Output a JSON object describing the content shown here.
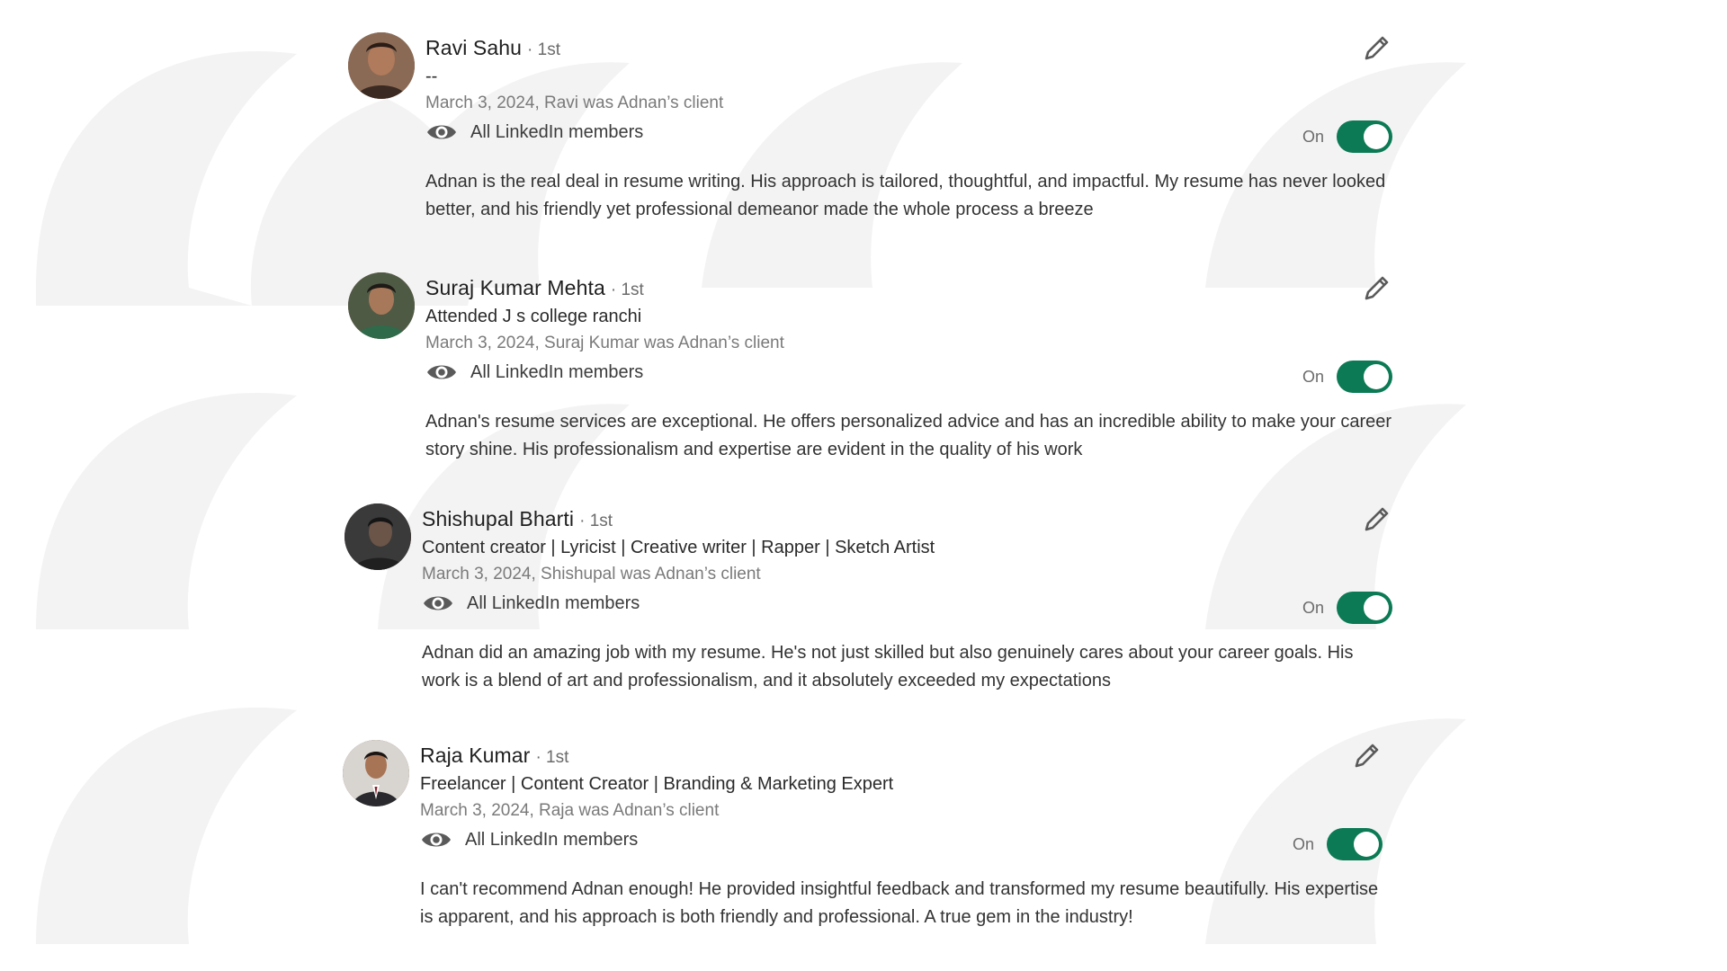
{
  "recommendations": [
    {
      "name": "Ravi Sahu",
      "degree": "· 1st",
      "headline": "--",
      "meta": "March 3, 2024, Ravi was Adnan’s client",
      "visibility": "All LinkedIn members",
      "toggle_label": "On",
      "toggle_on": true,
      "text": "Adnan is the real deal in resume writing. His approach is tailored, thoughtful, and impactful. My resume has never looked better, and his friendly yet professional demeanor made the whole process a breeze"
    },
    {
      "name": "Suraj Kumar Mehta",
      "degree": "· 1st",
      "headline": "Attended J s college ranchi",
      "meta": "March 3, 2024, Suraj Kumar was Adnan’s client",
      "visibility": "All LinkedIn members",
      "toggle_label": "On",
      "toggle_on": true,
      "text": "Adnan's resume services are exceptional. He offers personalized advice and has an incredible ability to make your career story shine. His professionalism and expertise are evident in the quality of his work"
    },
    {
      "name": "Shishupal Bharti",
      "degree": "· 1st",
      "headline": "Content creator | Lyricist | Creative writer | Rapper | Sketch Artist",
      "meta": "March 3, 2024, Shishupal was Adnan’s client",
      "visibility": "All LinkedIn members",
      "toggle_label": "On",
      "toggle_on": true,
      "text": "Adnan did an amazing job with my resume. He's not just skilled but also genuinely cares about your career goals. His work is a blend of art and professionalism, and it absolutely exceeded my expectations"
    },
    {
      "name": "Raja Kumar",
      "degree": "· 1st",
      "headline": "Freelancer | Content Creator | Branding & Marketing Expert",
      "meta": "March 3, 2024, Raja was Adnan’s client",
      "visibility": "All LinkedIn members",
      "toggle_label": "On",
      "toggle_on": true,
      "text": "I can't recommend Adnan enough! He provided insightful feedback and transformed my resume beautifully. His expertise is apparent, and his approach is both friendly and professional. A true gem in the industry!"
    }
  ],
  "colors": {
    "toggle_on": "#0b7a55",
    "name_text": "#1f1f1f",
    "meta_text": "#7a7a7a",
    "icon": "#5a5a5a"
  },
  "icons": {
    "edit": "pencil-icon",
    "visibility": "eye-icon"
  }
}
